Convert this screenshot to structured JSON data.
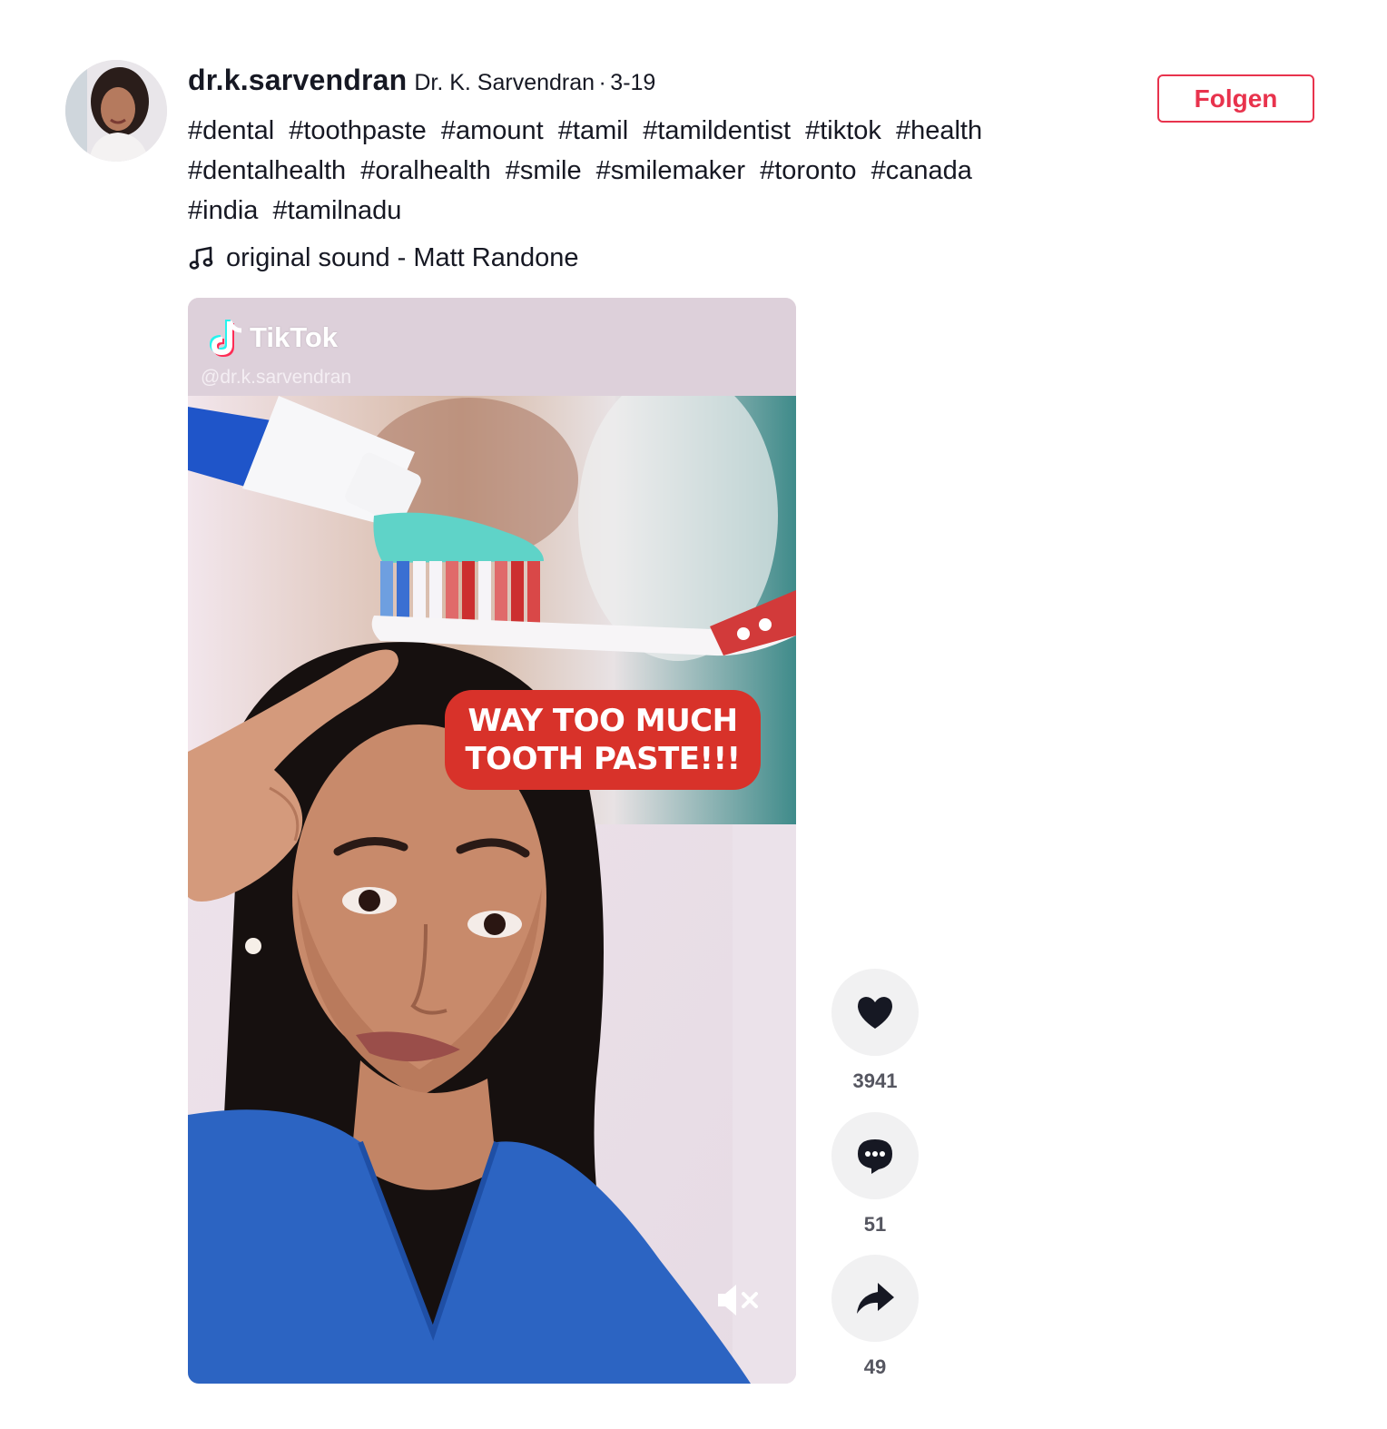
{
  "post": {
    "username": "dr.k.sarvendran",
    "nickname": "Dr. K. Sarvendran",
    "separator": "·",
    "date": "3-19",
    "follow_label": "Folgen",
    "hashtags": [
      "#dental",
      "#toothpaste",
      "#amount",
      "#tamil",
      "#tamildentist",
      "#tiktok",
      "#health",
      "#dentalhealth",
      "#oralhealth",
      "#smile",
      "#smilemaker",
      "#toronto",
      "#canada",
      "#india",
      "#tamilnadu"
    ],
    "sound": "original sound - Matt Randone"
  },
  "video": {
    "watermark_brand": "TikTok",
    "watermark_handle": "@dr.k.sarvendran",
    "overlay_line1": "WAY TOO MUCH",
    "overlay_line2": "TOOTH PASTE!!!"
  },
  "actions": {
    "likes": "3941",
    "comments": "51",
    "shares": "49"
  },
  "colors": {
    "accent": "#e8334d",
    "text": "#161823",
    "count": "#555660",
    "action_bg": "#f1f1f2",
    "overlay_red": "#d8322a"
  },
  "icons": [
    "music-note-icon",
    "tiktok-logo-icon",
    "mute-icon",
    "heart-icon",
    "comment-icon",
    "share-icon"
  ]
}
